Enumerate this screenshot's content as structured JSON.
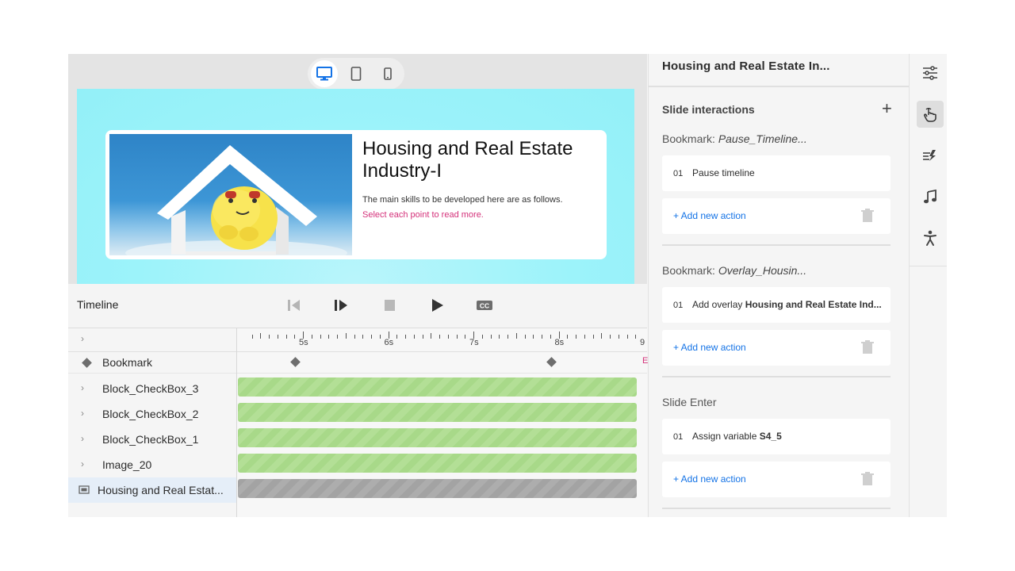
{
  "device_toggle": {
    "options": [
      "desktop-icon",
      "tablet-icon",
      "mobile-icon"
    ],
    "active": "desktop"
  },
  "slide": {
    "title": "Housing and Real Estate Industry-I",
    "body": "The main skills to be developed here are as follows.",
    "link": "Select each point to read more.",
    "colors": {
      "background": "#9cf3fa",
      "link": "#d4317a"
    }
  },
  "timeline": {
    "title": "Timeline",
    "controls": [
      "step-back-icon",
      "play-pause-icon",
      "stop-icon",
      "play-icon",
      "closed-captions-icon"
    ],
    "ruler_labels": [
      "5s",
      "6s",
      "7s",
      "8s",
      "9"
    ],
    "bookmark_label": "Bookmark",
    "bookmark_times": [
      "5s",
      "8s"
    ],
    "layers": [
      {
        "label": "Block_CheckBox_3"
      },
      {
        "label": "Block_CheckBox_2"
      },
      {
        "label": "Block_CheckBox_1"
      },
      {
        "label": "Image_20"
      },
      {
        "label": "Housing and Real Estat..."
      }
    ]
  },
  "panel": {
    "title": "Housing and Real Estate In...",
    "section_title": "Slide interactions",
    "groups": [
      {
        "prefix": "Bookmark:",
        "name": "Pause_Timeline...",
        "action_num": "01",
        "action_text": "Pause timeline",
        "action_bold": "",
        "add_label": "+ Add new action"
      },
      {
        "prefix": "Bookmark:",
        "name": "Overlay_Housin...",
        "action_num": "01",
        "action_text": "Add overlay",
        "action_bold": "Housing and Real Estate Ind...",
        "add_label": "+ Add new action"
      },
      {
        "prefix": "Slide Enter",
        "name": "",
        "action_num": "01",
        "action_text": "Assign variable",
        "action_bold": "S4_5",
        "add_label": "+ Add new action"
      }
    ],
    "colors": {
      "accent": "#1473e6"
    }
  },
  "rail": {
    "icons": [
      "properties-sliders-icon",
      "interactions-hand-icon",
      "effects-icon",
      "audio-note-icon",
      "accessibility-icon"
    ],
    "active": "interactions-hand-icon"
  }
}
